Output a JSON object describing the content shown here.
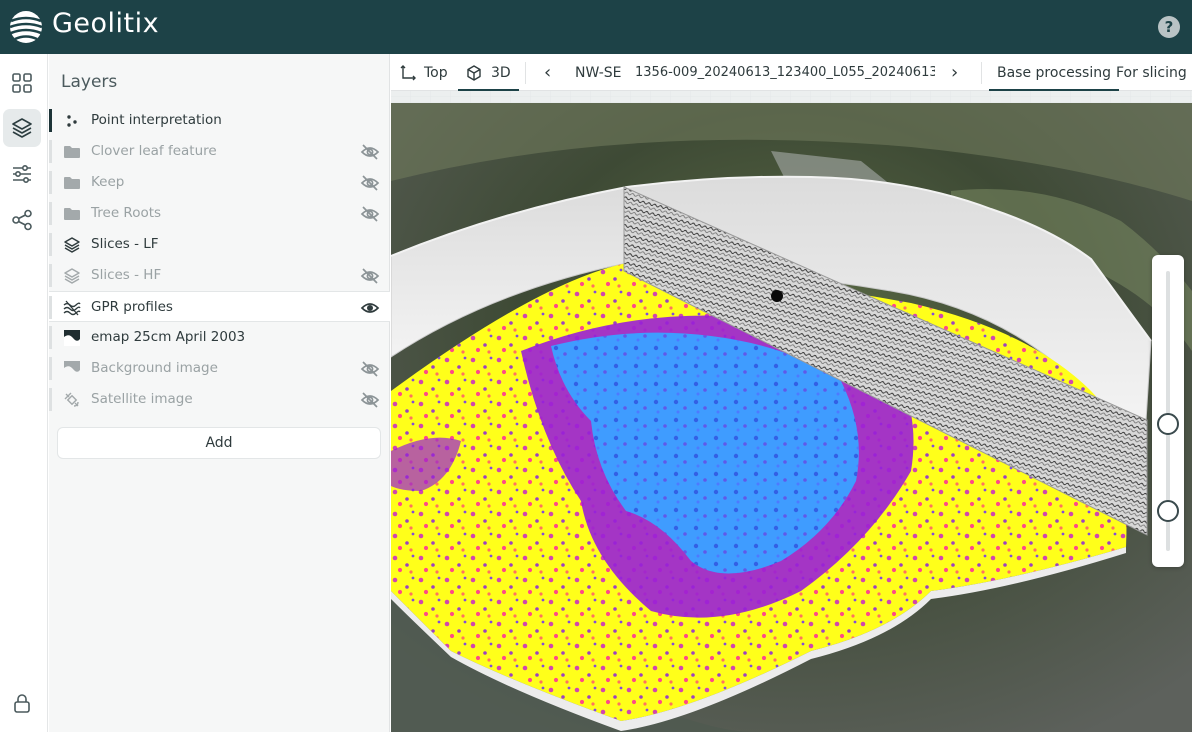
{
  "app": {
    "name": "Geolitix",
    "help_label": "?"
  },
  "rail": {
    "items": [
      {
        "name": "grid-icon"
      },
      {
        "name": "layers-icon",
        "active": true
      },
      {
        "name": "sliders-icon"
      },
      {
        "name": "share-icon"
      }
    ],
    "bottom": {
      "name": "lock-icon"
    }
  },
  "layers": {
    "title": "Layers",
    "items": [
      {
        "label": "Point interpretation",
        "icon": "points-icon",
        "visible": true,
        "selected": true
      },
      {
        "label": "Clover leaf feature",
        "icon": "folder-icon",
        "visible": false
      },
      {
        "label": "Keep",
        "icon": "folder-icon",
        "visible": false
      },
      {
        "label": "Tree Roots",
        "icon": "folder-icon",
        "visible": false
      },
      {
        "label": "Slices - LF",
        "icon": "stack-icon",
        "visible": true
      },
      {
        "label": "Slices - HF",
        "icon": "stack-icon",
        "visible": false
      },
      {
        "label": "GPR profiles",
        "icon": "profiles-icon",
        "visible": true,
        "highlighted": true
      },
      {
        "label": "emap 25cm April 2003",
        "icon": "image-icon",
        "visible": true
      },
      {
        "label": "Background image",
        "icon": "image-icon",
        "visible": false
      },
      {
        "label": "Satellite image",
        "icon": "satellite-icon",
        "visible": false
      }
    ],
    "add_label": "Add"
  },
  "toolbar": {
    "top_label": "Top",
    "threed_label": "3D",
    "prev_label": "‹",
    "direction": "NW-SE",
    "profile_name": "1356-009_20240613_123400_L055_20240613...",
    "next_label": "›",
    "base_label": "Base processing",
    "slicing_label": "For slicing"
  },
  "colors": {
    "header": "#1d4247",
    "accent": "#1d4247",
    "panel": "#f6f7f7",
    "heat_high": "#3f9cff",
    "heat_mid": "#9a1fd8",
    "heat_low": "#ffff1a"
  },
  "elevation_slider": {
    "upper_value": 0.61,
    "lower_value": 0.28
  }
}
